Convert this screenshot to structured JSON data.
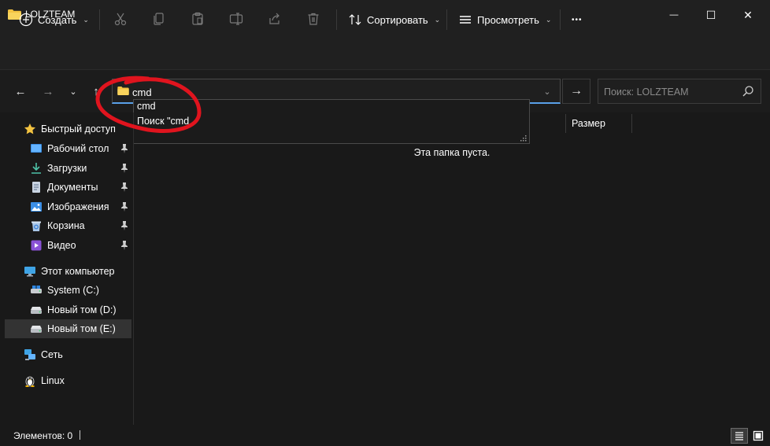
{
  "window": {
    "title": "LOLZTEAM",
    "minimize_glyph": "—",
    "maximize_glyph": "☐",
    "close_glyph": "✕"
  },
  "toolbar": {
    "create_label": "Создать",
    "sort_label": "Сортировать",
    "view_label": "Просмотреть",
    "more_glyph": "•••",
    "icons": [
      "plus-icon",
      "cut-icon",
      "copy-icon",
      "paste-icon",
      "rename-icon",
      "share-icon",
      "delete-icon",
      "sort-icon",
      "view-icon",
      "more-icon"
    ]
  },
  "address": {
    "value": "cmd",
    "suggestions": [
      "cmd",
      "Поиск \"cmd"
    ]
  },
  "search": {
    "placeholder": "Поиск: LOLZTEAM"
  },
  "content": {
    "column_size": "Размер",
    "empty_message": "Эта папка пуста."
  },
  "sidebar": {
    "quick_access": "Быстрый доступ",
    "quick_items": [
      {
        "label": "Рабочий стол",
        "icon": "desktop-icon"
      },
      {
        "label": "Загрузки",
        "icon": "download-icon"
      },
      {
        "label": "Документы",
        "icon": "documents-icon"
      },
      {
        "label": "Изображения",
        "icon": "pictures-icon"
      },
      {
        "label": "Корзина",
        "icon": "recycle-bin-icon"
      },
      {
        "label": "Видео",
        "icon": "videos-icon"
      }
    ],
    "this_pc": "Этот компьютер",
    "drives": [
      {
        "label": "System (C:)",
        "icon": "drive-icon"
      },
      {
        "label": "Новый том (D:)",
        "icon": "drive-icon"
      },
      {
        "label": "Новый том (E:)",
        "icon": "drive-icon",
        "selected": true
      }
    ],
    "network": "Сеть",
    "linux": "Linux"
  },
  "status": {
    "items_text": "Элементов: 0"
  },
  "colors": {
    "accent": "#5aa0e8",
    "folder": "#f3c341",
    "annotation": "#e0141e"
  }
}
